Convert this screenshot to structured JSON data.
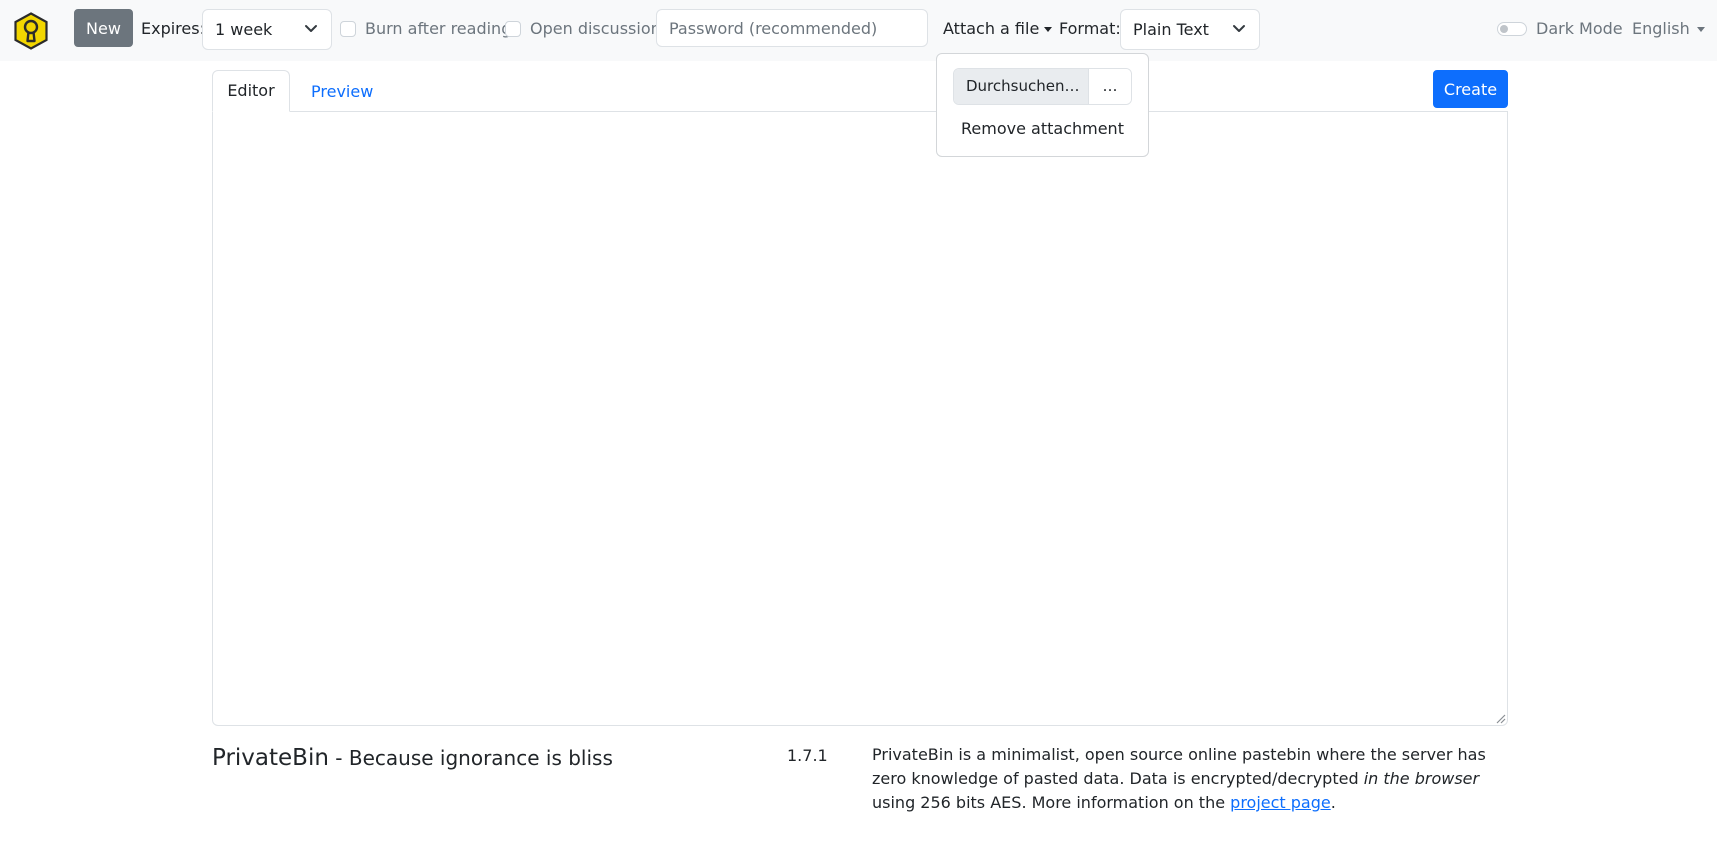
{
  "navbar": {
    "logo_icon": "keyhole-hexagon-icon",
    "new_label": "New",
    "expires_label": "Expires:",
    "expires_value": "1 week",
    "burn_label": "Burn after reading",
    "discussion_label": "Open discussion",
    "password_placeholder": "Password (recommended)",
    "attach_label": "Attach a file",
    "format_label": "Format:",
    "format_value": "Plain Text",
    "dark_mode_label": "Dark Mode",
    "language": "English"
  },
  "attach_menu": {
    "browse_label": "Durchsuchen…",
    "file_name": "…",
    "remove_label": "Remove attachment"
  },
  "editor": {
    "tab_editor": "Editor",
    "tab_preview": "Preview",
    "create_label": "Create",
    "content": ""
  },
  "footer": {
    "brand": "PrivateBin",
    "tagline": " - Because ignorance is bliss",
    "version": "1.7.1",
    "about_part1": "PrivateBin is a minimalist, open source online pastebin where the server has zero knowledge of pasted data. Data is encrypted/decrypted ",
    "about_emph": "in the browser",
    "about_part2": " using 256 bits AES. More information on the ",
    "about_link": "project page",
    "about_end": "."
  },
  "colors": {
    "primary": "#0d6efd",
    "secondary": "#6c757d",
    "navbar_bg": "#f8f9fa",
    "logo_yellow": "#f2d600"
  }
}
